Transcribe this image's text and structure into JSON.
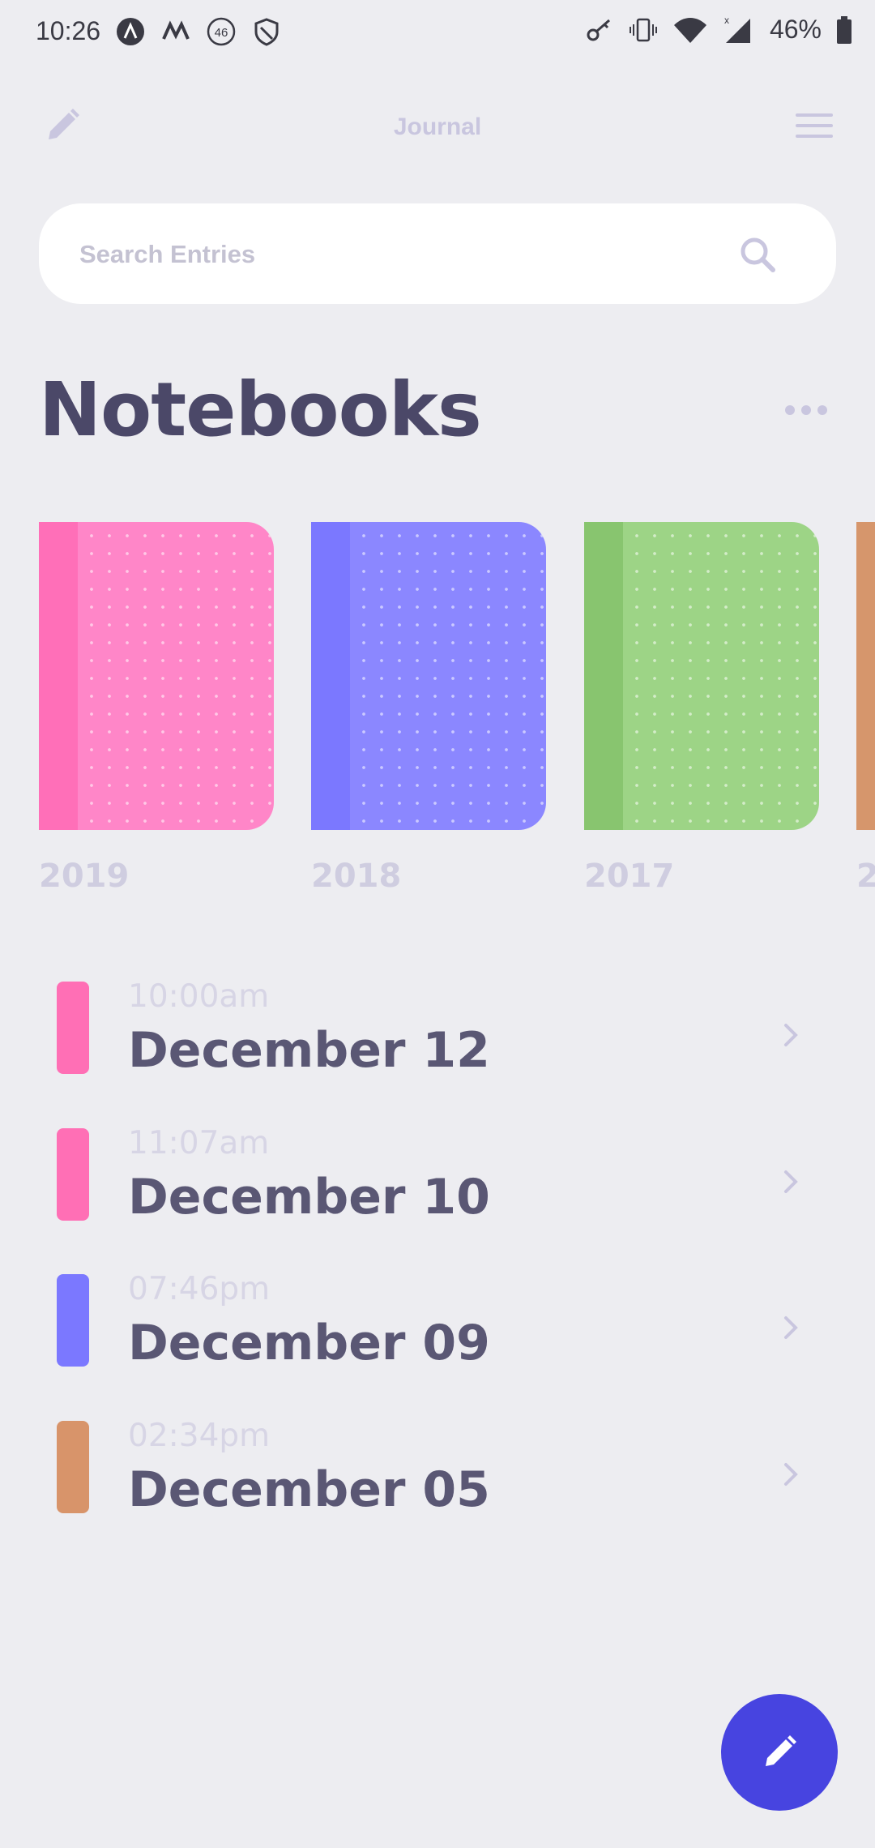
{
  "status_bar": {
    "time": "10:26",
    "battery": "46%"
  },
  "header": {
    "title": "Journal"
  },
  "search": {
    "placeholder": "Search Entries"
  },
  "section": {
    "title": "Notebooks"
  },
  "notebooks": [
    {
      "year": "2019",
      "color": "#FF86C8",
      "spine": "#FF6FB8"
    },
    {
      "year": "2018",
      "color": "#8B87FF",
      "spine": "#7B78FF"
    },
    {
      "year": "2017",
      "color": "#9DD486",
      "spine": "#88C56F"
    },
    {
      "year": "2",
      "color": "#D6966C",
      "spine": "#D6966C"
    }
  ],
  "entries": [
    {
      "time": "10:00am",
      "date": "December 12",
      "color": "#FF6FB5"
    },
    {
      "time": "11:07am",
      "date": "December 10",
      "color": "#FF6FB5"
    },
    {
      "time": "07:46pm",
      "date": "December 09",
      "color": "#7B78FF"
    },
    {
      "time": "02:34pm",
      "date": "December 05",
      "color": "#D8946A"
    }
  ],
  "colors": {
    "accent": "#4744E0",
    "background": "#EDEDF1",
    "text": "#4B4868"
  }
}
